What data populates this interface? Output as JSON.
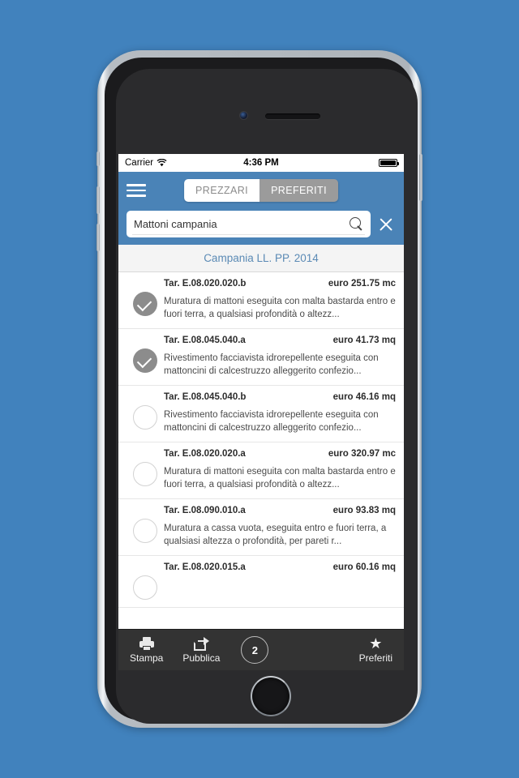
{
  "status_bar": {
    "carrier": "Carrier",
    "wifi_icon": "wifi-icon",
    "time": "4:36 PM",
    "battery_icon": "battery-full-icon"
  },
  "header": {
    "menu_icon": "hamburger-menu-icon",
    "segments": [
      {
        "label": "PREZZARI",
        "active": false
      },
      {
        "label": "PREFERITI",
        "active": true
      }
    ],
    "search": {
      "value": "Mattoni campania",
      "placeholder": "Cerca",
      "search_icon": "search-icon",
      "clear_icon": "close-icon"
    },
    "background_color": "#4a83b7"
  },
  "section": {
    "title": "Campania LL. PP. 2014"
  },
  "list": {
    "items": [
      {
        "selected": true,
        "code": "Tar. E.08.020.020.b",
        "price": "euro 251.75 mc",
        "description": "Muratura di mattoni eseguita con malta bastarda entro e fuori terra, a qualsiasi profondità o altezz..."
      },
      {
        "selected": true,
        "code": "Tar. E.08.045.040.a",
        "price": "euro 41.73 mq",
        "description": "Rivestimento facciavista idrorepellente eseguita con mattoncini di calcestruzzo alleggerito confezio..."
      },
      {
        "selected": false,
        "code": "Tar. E.08.045.040.b",
        "price": "euro 46.16 mq",
        "description": "Rivestimento facciavista idrorepellente eseguita con mattoncini di calcestruzzo alleggerito confezio..."
      },
      {
        "selected": false,
        "code": "Tar. E.08.020.020.a",
        "price": "euro 320.97 mc",
        "description": "Muratura di mattoni eseguita con malta bastarda entro e fuori terra, a qualsiasi profondità o altezz..."
      },
      {
        "selected": false,
        "code": "Tar. E.08.090.010.a",
        "price": "euro 93.83 mq",
        "description": "Muratura a cassa vuota, eseguita entro e fuori terra, a qualsiasi altezza o profondità, per pareti r..."
      },
      {
        "selected": false,
        "code": "Tar. E.08.020.015.a",
        "price": "euro 60.16 mq",
        "description": ""
      }
    ]
  },
  "toolbar": {
    "print_label": "Stampa",
    "print_icon": "printer-icon",
    "share_label": "Pubblica",
    "share_icon": "share-icon",
    "count_badge": "2",
    "favorites_label": "Preferiti",
    "favorites_icon": "star-icon",
    "background_color": "#333333"
  },
  "page_background_color": "#4182bd"
}
